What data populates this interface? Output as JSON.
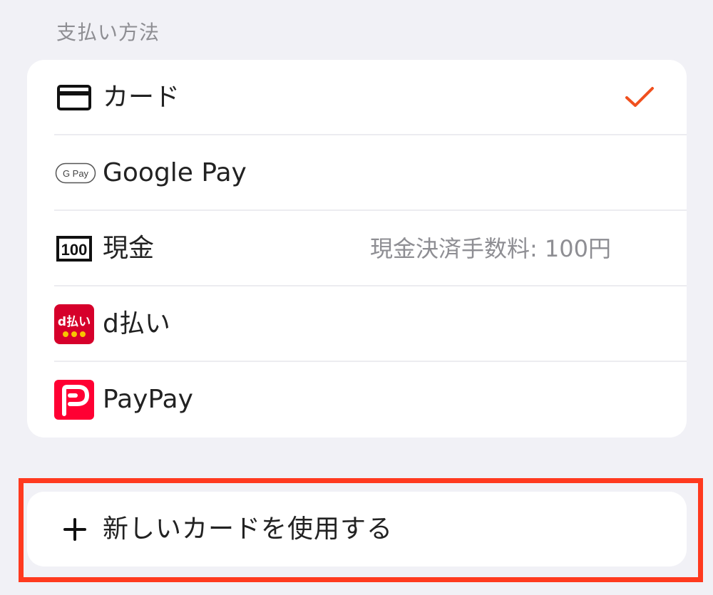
{
  "section": {
    "label": "支払い方法"
  },
  "payment_methods": [
    {
      "label": "カード",
      "icon": "credit-card-icon",
      "selected": true,
      "note": ""
    },
    {
      "label": "Google Pay",
      "icon": "google-pay-icon",
      "icon_text": "G Pay",
      "selected": false,
      "note": ""
    },
    {
      "label": "現金",
      "icon": "cash-100-icon",
      "icon_text": "100",
      "selected": false,
      "note": "現金決済手数料: 100円"
    },
    {
      "label": "d払い",
      "icon": "d-barai-icon",
      "icon_text": "d払い",
      "selected": false,
      "note": ""
    },
    {
      "label": "PayPay",
      "icon": "paypay-icon",
      "selected": false,
      "note": ""
    }
  ],
  "new_card": {
    "label": "新しいカードを使用する",
    "icon": "plus-icon"
  },
  "colors": {
    "accent": "#f0501e",
    "highlight_border": "#ff3a1f",
    "d_barai_brand": "#d6002b",
    "paypay_brand": "#ff0033",
    "background": "#f1f1f6",
    "card": "#ffffff",
    "muted_text": "#8e8e93"
  }
}
